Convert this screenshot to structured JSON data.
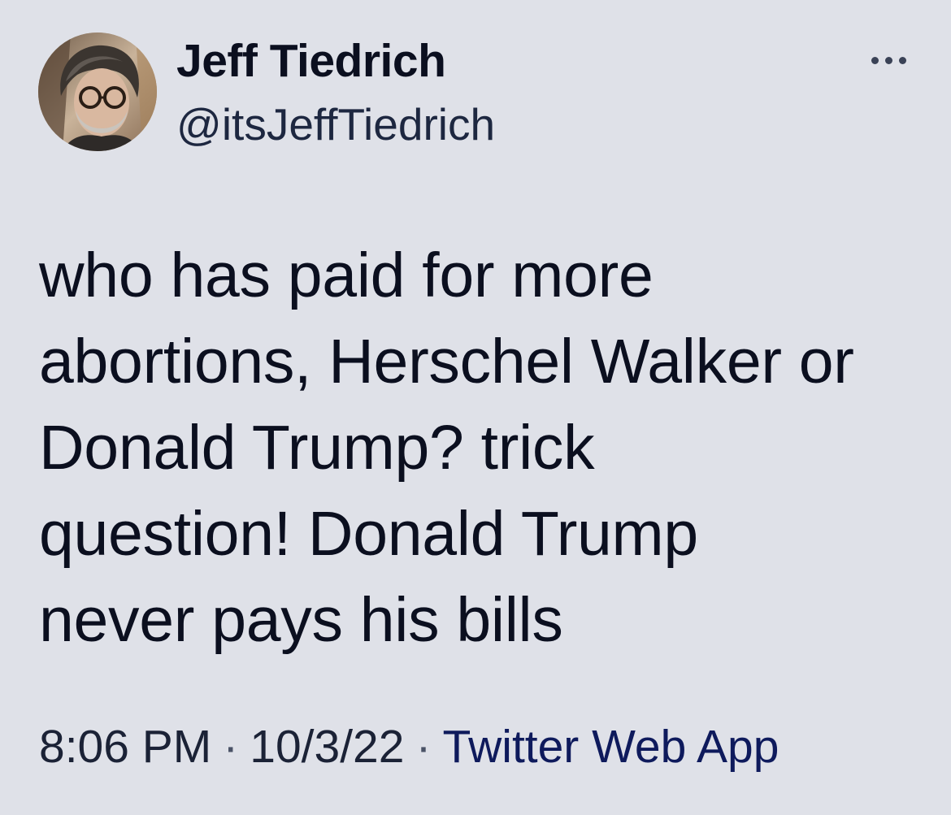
{
  "author": {
    "display_name": "Jeff Tiedrich",
    "handle": "@itsJeffTiedrich",
    "avatar_icon": "profile-photo"
  },
  "tweet": {
    "text": "who has paid for more\nabortions, Herschel Walker or\nDonald Trump? trick\nquestion! Donald Trump\nnever pays his bills"
  },
  "meta": {
    "time": "8:06 PM",
    "date": "10/3/22",
    "separator": "·",
    "source": "Twitter Web App"
  },
  "more_icon": "more-horizontal-icon",
  "colors": {
    "background": "#dfe1e8",
    "text": "#0b0f1f",
    "source_link": "#0e1a5c"
  }
}
